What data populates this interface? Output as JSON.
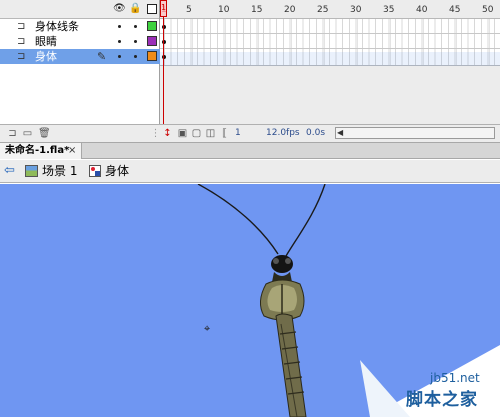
{
  "timeline": {
    "layers": [
      {
        "name": "身体线条",
        "color": "#3fd33f",
        "selected": false
      },
      {
        "name": "眼睛",
        "color": "#9b2fb8",
        "selected": false
      },
      {
        "name": "身体",
        "color": "#f08c1a",
        "selected": true
      }
    ],
    "header_icons": [
      "eye-icon",
      "lock-icon",
      "outline-icon"
    ],
    "ruler_ticks": [
      "1",
      "5",
      "10",
      "15",
      "20",
      "25",
      "30",
      "35",
      "40",
      "45",
      "50"
    ],
    "current_frame": "1",
    "frame_rate": "12.0",
    "frame_rate_unit": "fps",
    "elapsed_time": "0.0s"
  },
  "document": {
    "tab_title": "未命名-1.fla*",
    "close_glyph": "×"
  },
  "edit_bar": {
    "scene_label": "场景 1",
    "symbol_label": "身体"
  },
  "stage": {
    "background": "#6f96f2"
  },
  "watermark": {
    "url": "jb51.net",
    "site_name": "脚本之家"
  }
}
